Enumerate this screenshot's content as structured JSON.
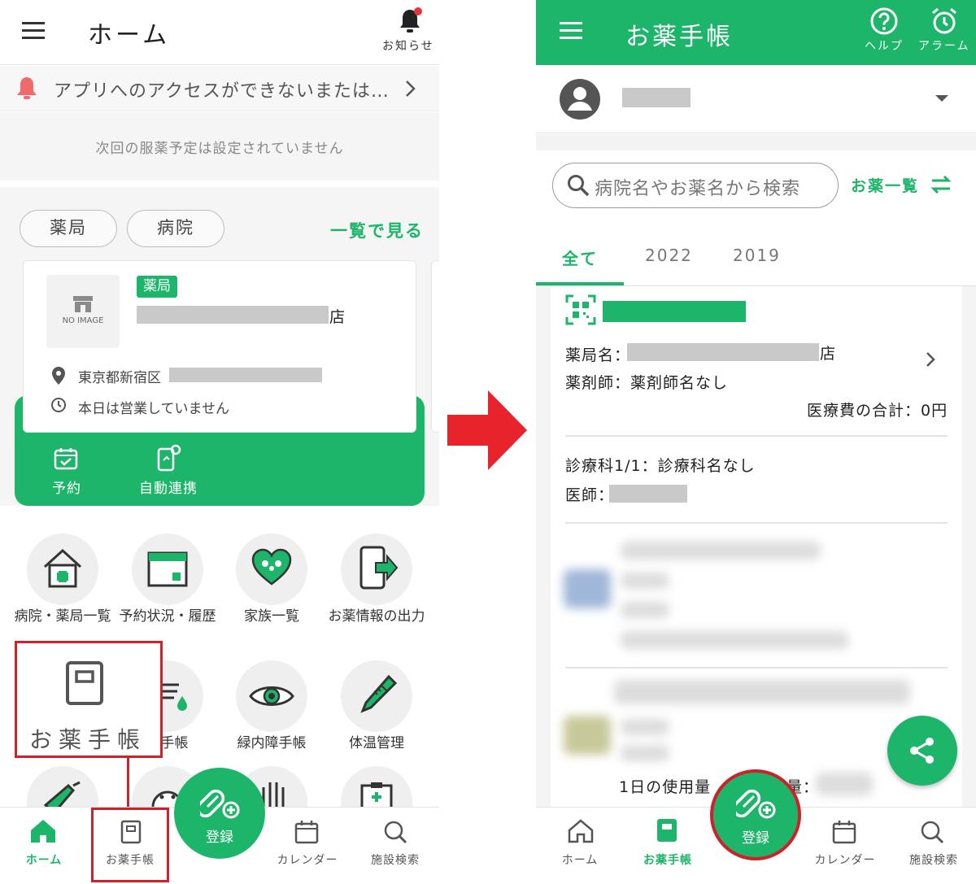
{
  "left": {
    "header": {
      "title": "ホーム",
      "notifications_label": "お知らせ"
    },
    "notice": {
      "text": "アプリへのアクセスができないまたは…"
    },
    "schedule": {
      "text": "次回の服薬予定は設定されていません"
    },
    "facility_tabs": {
      "pharmacy": "薬局",
      "hospital": "病院",
      "view_all": "一覧で見る"
    },
    "facility_card": {
      "no_image": "NO IMAGE",
      "tag": "薬局",
      "name_suffix": "店",
      "address_prefix": "東京都新宿区",
      "hours": "本日は営業していません",
      "actions": {
        "reserve": "予約",
        "auto_link": "自動連携"
      }
    },
    "menu": {
      "row1": [
        "病院・薬局一覧",
        "予約状況・履歴",
        "家族一覧",
        "お薬情報の出力"
      ],
      "row2": [
        "病手帳",
        "緑内障手帳",
        "体温管理"
      ],
      "highlight_label": "お薬手帳"
    },
    "bottom_nav": {
      "home": "ホーム",
      "notebook": "お薬手帳",
      "register": "登録",
      "calendar": "カレンダー",
      "facility_search": "施設検索"
    }
  },
  "right": {
    "header": {
      "title": "お薬手帳",
      "help_label": "ヘルプ",
      "alarm_label": "アラーム"
    },
    "search": {
      "placeholder": "病院名やお薬名から検索",
      "med_list": "お薬一覧"
    },
    "tabs": [
      "全て",
      "2022",
      "2019"
    ],
    "record": {
      "pharmacy_label": "薬局名：",
      "pharmacy_suffix": "店",
      "pharmacist": "薬剤師：薬剤師名なし",
      "total": "医療費の合計：0円",
      "department": "診療科1/1：診療科名なし",
      "doctor_label": "医師：",
      "daily_usage": "1日の使用量",
      "usage_suffix": "量："
    },
    "bottom_nav": {
      "home": "ホーム",
      "notebook": "お薬手帳",
      "register": "登録",
      "calendar": "カレンダー",
      "facility_search": "施設検索"
    }
  },
  "colors": {
    "accent": "#1db56a",
    "highlight": "#d0202a",
    "arrow": "#e8232b"
  }
}
